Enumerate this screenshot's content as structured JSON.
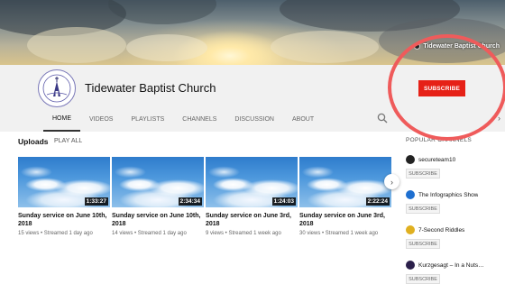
{
  "banner": {
    "channel_link": "Tidewater Baptist Church"
  },
  "channel": {
    "name": "Tidewater Baptist Church",
    "subscribe_label": "SUBSCRIBE"
  },
  "tabs": [
    {
      "label": "HOME",
      "active": true
    },
    {
      "label": "VIDEOS"
    },
    {
      "label": "PLAYLISTS"
    },
    {
      "label": "CHANNELS"
    },
    {
      "label": "DISCUSSION"
    },
    {
      "label": "ABOUT"
    }
  ],
  "uploads": {
    "title": "Uploads",
    "play_all": "PLAY ALL",
    "videos": [
      {
        "duration": "1:33:27",
        "title": "Sunday service on June 10th, 2018",
        "meta": "15 views • Streamed 1 day ago"
      },
      {
        "duration": "2:34:34",
        "title": "Sunday service on June 10th, 2018",
        "meta": "14 views • Streamed 1 day ago"
      },
      {
        "duration": "1:24:03",
        "title": "Sunday service on June 3rd, 2018",
        "meta": "9 views • Streamed 1 week ago"
      },
      {
        "duration": "2:22:24",
        "title": "Sunday service on June 3rd, 2018",
        "meta": "30 views • Streamed 1 week ago"
      }
    ]
  },
  "popular_channels": {
    "title": "POPULAR CHANNELS",
    "subscribe_label": "SUBSCRIBE",
    "items": [
      {
        "name": "secureteam10",
        "icon_color": "#222222"
      },
      {
        "name": "The Infographics Show",
        "icon_color": "#1e6fd0"
      },
      {
        "name": "7-Second Riddles",
        "icon_color": "#e0b020"
      },
      {
        "name": "Kurzgesagt – In a Nuts…",
        "icon_color": "#2b1f4a"
      }
    ]
  },
  "colors": {
    "subscribe_red": "#e62117",
    "annotation_circle": "#ef5b5b"
  }
}
